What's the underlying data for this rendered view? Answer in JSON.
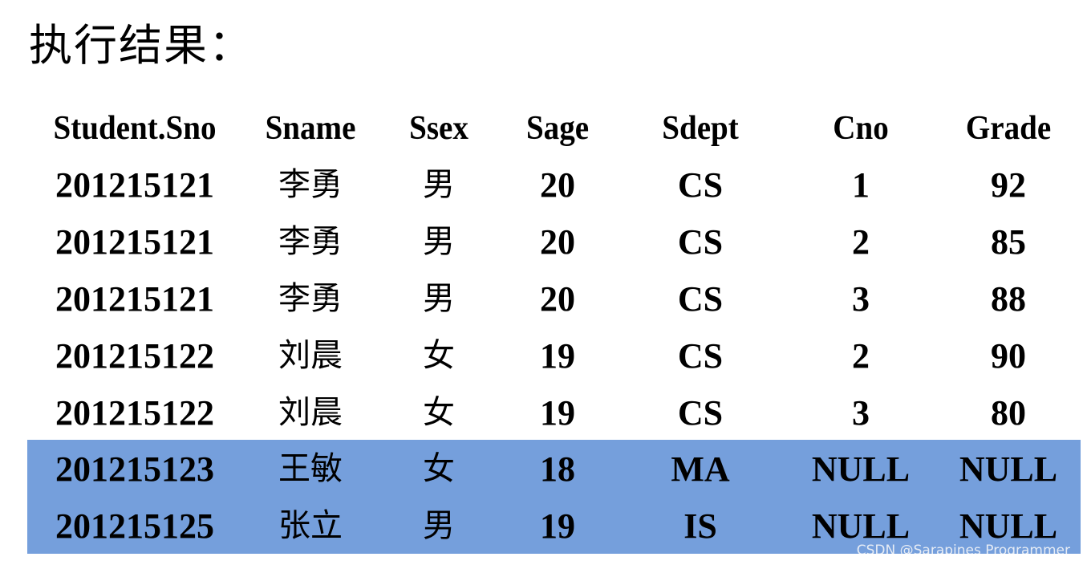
{
  "title": "执行结果：",
  "highlight_color": "#759fdc",
  "table": {
    "headers": [
      "Student.Sno",
      "Sname",
      "Ssex",
      "Sage",
      "Sdept",
      "Cno",
      "Grade"
    ],
    "rows": [
      [
        "201215121",
        "李勇",
        "男",
        "20",
        "CS",
        "1",
        "92"
      ],
      [
        "201215121",
        "李勇",
        "男",
        "20",
        "CS",
        "2",
        "85"
      ],
      [
        "201215121",
        "李勇",
        "男",
        "20",
        "CS",
        "3",
        "88"
      ],
      [
        "201215122",
        "刘晨",
        "女",
        "19",
        "CS",
        "2",
        "90"
      ],
      [
        "201215122",
        "刘晨",
        "女",
        "19",
        "CS",
        "3",
        "80"
      ],
      [
        "201215123",
        "王敏",
        "女",
        "18",
        "MA",
        "NULL",
        "NULL"
      ],
      [
        "201215125",
        "张立",
        "男",
        "19",
        "IS",
        "NULL",
        "NULL"
      ]
    ],
    "highlighted_rows": [
      5,
      6
    ]
  },
  "watermark": "CSDN @Sarapines Programmer"
}
